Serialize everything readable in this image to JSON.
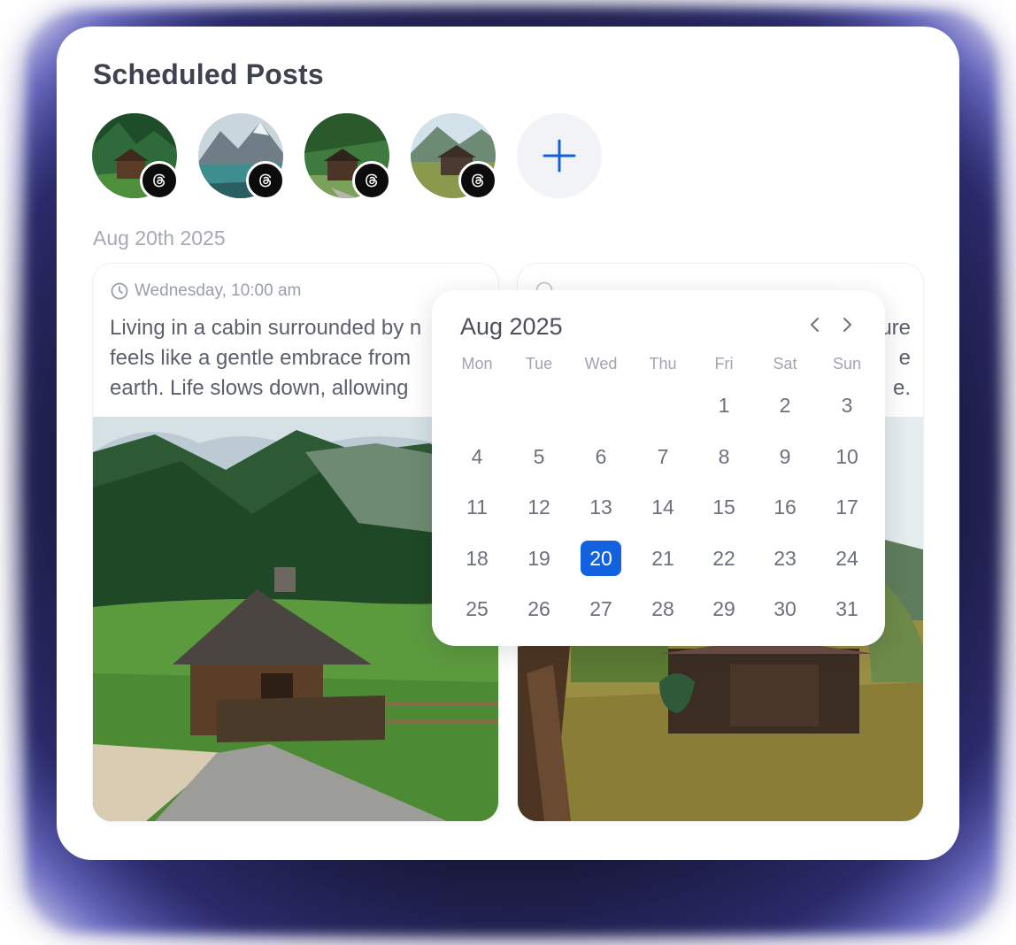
{
  "title": "Scheduled Posts",
  "accent_color": "#1262e0",
  "accounts": [
    {
      "platform_icon": "threads-icon"
    },
    {
      "platform_icon": "threads-icon"
    },
    {
      "platform_icon": "threads-icon"
    },
    {
      "platform_icon": "threads-icon"
    }
  ],
  "add_icon": "plus-icon",
  "date_label": "Aug 20th 2025",
  "posts": [
    {
      "time": "Wednesday, 10:00 am",
      "text_lines": [
        "Living in a cabin surrounded by n",
        "feels like a gentle embrace from",
        "earth. Life slows down, allowing"
      ]
    },
    {
      "text_lines": [
        "ure",
        "e",
        "e."
      ]
    }
  ],
  "calendar": {
    "month_label": "Aug 2025",
    "weekdays": [
      "Mon",
      "Tue",
      "Wed",
      "Thu",
      "Fri",
      "Sat",
      "Sun"
    ],
    "first_weekday_index": 4,
    "days_in_month": 31,
    "selected_day": 20
  }
}
